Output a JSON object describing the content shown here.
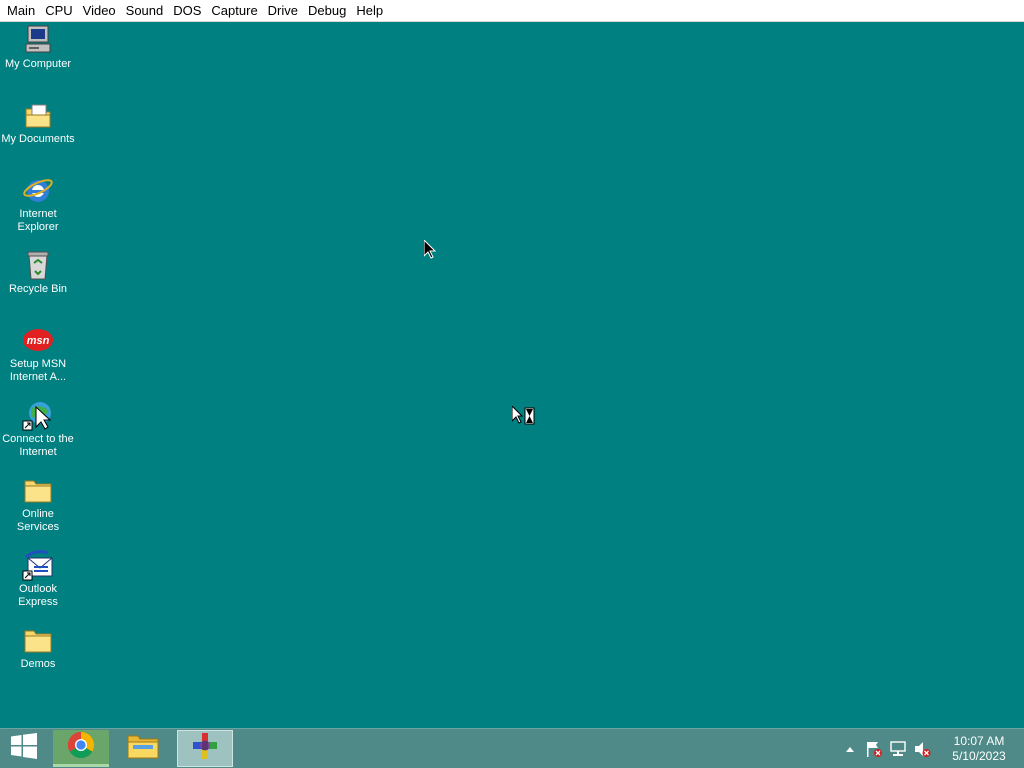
{
  "menubar": {
    "items": [
      "Main",
      "CPU",
      "Video",
      "Sound",
      "DOS",
      "Capture",
      "Drive",
      "Debug",
      "Help"
    ]
  },
  "desktop": {
    "background_color": "#008080",
    "icons": [
      {
        "label": "My Computer",
        "icon": "my-computer-icon"
      },
      {
        "label": "My Documents",
        "icon": "my-documents-icon"
      },
      {
        "label": "Internet Explorer",
        "icon": "internet-explorer-icon"
      },
      {
        "label": "Recycle Bin",
        "icon": "recycle-bin-icon"
      },
      {
        "label": "Setup MSN Internet A...",
        "icon": "msn-icon"
      },
      {
        "label": "Connect to the Internet",
        "icon": "connect-internet-icon"
      },
      {
        "label": "Online Services",
        "icon": "folder-icon"
      },
      {
        "label": "Outlook Express",
        "icon": "outlook-express-icon"
      },
      {
        "label": "Demos",
        "icon": "folder-icon"
      }
    ]
  },
  "taskbar": {
    "start_icon": "windows-logo-icon",
    "apps": [
      {
        "name": "Google Chrome",
        "icon": "chrome-icon"
      },
      {
        "name": "File Explorer",
        "icon": "file-explorer-icon"
      },
      {
        "name": "DOSBox-X",
        "icon": "dosbox-icon"
      }
    ],
    "tray": {
      "icons": [
        "show-hidden-icons-icon",
        "action-center-flag-icon",
        "network-icon",
        "volume-muted-icon"
      ],
      "time": "10:07 AM",
      "date": "5/10/2023"
    }
  }
}
